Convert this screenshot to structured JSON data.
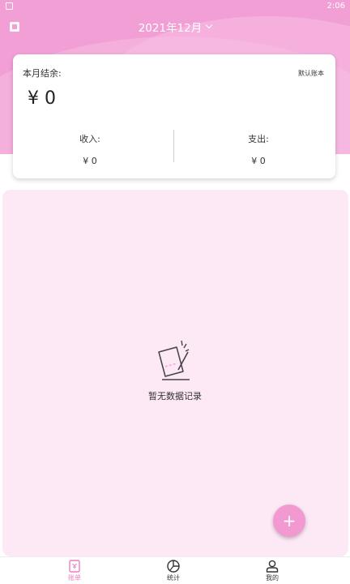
{
  "status_bar": {
    "time": "2:06"
  },
  "header": {
    "month": "2021年12月"
  },
  "summary": {
    "balance_label": "本月结余:",
    "account_link": "默认账本",
    "balance": "¥ 0",
    "income_label": "收入:",
    "income_value": "¥ 0",
    "expense_label": "支出:",
    "expense_value": "¥ 0"
  },
  "empty_state": {
    "text": "暂无数据记录"
  },
  "fab": {
    "label": "+"
  },
  "tabs": [
    {
      "label": "账单",
      "icon": "bill-icon",
      "active": true
    },
    {
      "label": "统计",
      "icon": "pie-chart-icon",
      "active": false
    },
    {
      "label": "我的",
      "icon": "user-icon",
      "active": false
    }
  ],
  "colors": {
    "header_pink": "#f29fd6",
    "list_bg": "#fde8f5",
    "accent": "#ef7dbf"
  }
}
